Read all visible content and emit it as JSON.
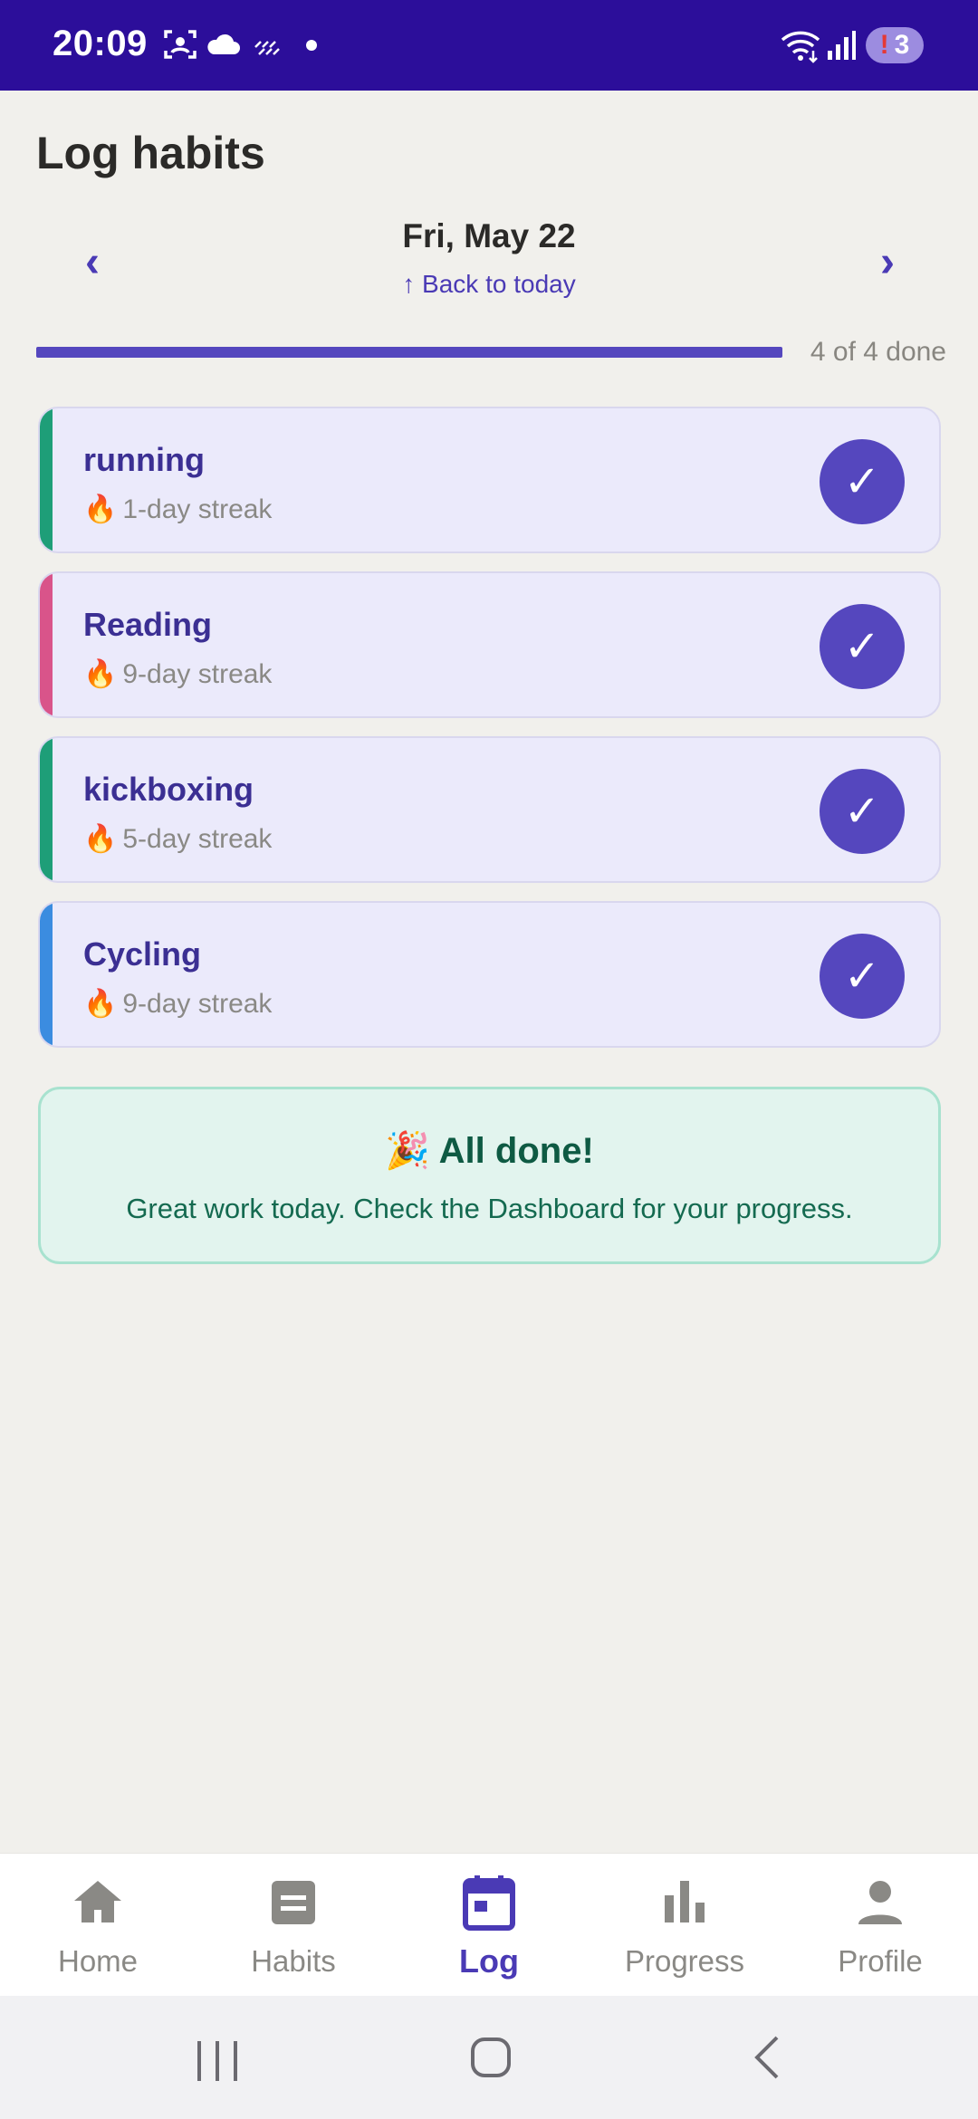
{
  "status_bar": {
    "time": "20:09",
    "notification_count": "3",
    "icons": [
      "screenshot-icon",
      "cloud-icon",
      "weather-icon",
      "dot-icon",
      "wifi-icon",
      "signal-icon",
      "alert-badge-icon"
    ]
  },
  "header": {
    "title": "Log habits",
    "date": "Fri, May 22",
    "back_to_today": "↑ Back to today",
    "prev_icon": "‹",
    "next_icon": "›"
  },
  "progress": {
    "done": 4,
    "total": 4,
    "fraction": 1.0,
    "label": "4 of 4 done"
  },
  "habits": [
    {
      "name": "running",
      "streak": "1-day streak",
      "color": "#1E9E78",
      "done": true
    },
    {
      "name": "Reading",
      "streak": "9-day streak",
      "color": "#D9548A",
      "done": true
    },
    {
      "name": "kickboxing",
      "streak": "5-day streak",
      "color": "#1E9E78",
      "done": true
    },
    {
      "name": "Cycling",
      "streak": "9-day streak",
      "color": "#3B8CE0",
      "done": true
    }
  ],
  "completion": {
    "emoji": "🎉",
    "title": "All done!",
    "message": "Great work today. Check the Dashboard for your progress."
  },
  "bottom_nav": {
    "items": [
      {
        "label": "Home",
        "icon": "home-icon",
        "active": false
      },
      {
        "label": "Habits",
        "icon": "habits-icon",
        "active": false
      },
      {
        "label": "Log",
        "icon": "calendar-icon",
        "active": true
      },
      {
        "label": "Progress",
        "icon": "bar-chart-icon",
        "active": false
      },
      {
        "label": "Profile",
        "icon": "person-icon",
        "active": false
      }
    ]
  },
  "colors": {
    "status_bar": "#2C0E9A",
    "accent": "#5547BE",
    "background": "#F1F0EC",
    "card_bg": "#EBEAFB",
    "success_bg": "#E2F4EE",
    "success_text": "#0E5A43"
  }
}
